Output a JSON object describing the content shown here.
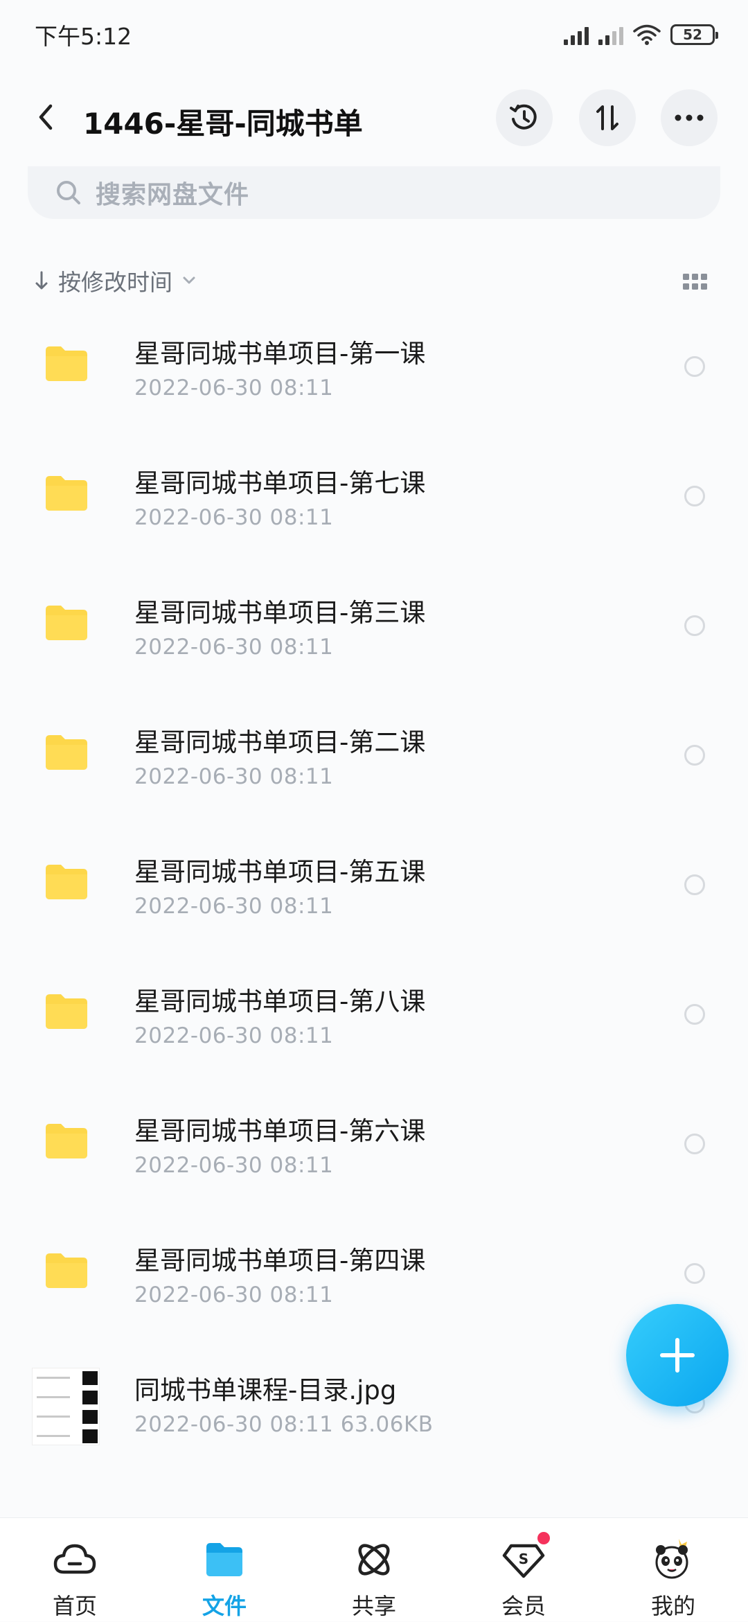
{
  "status_bar": {
    "time": "下午5:12",
    "battery": "52"
  },
  "header": {
    "title": "1446-星哥-同城书单"
  },
  "search": {
    "placeholder": "搜索网盘文件"
  },
  "sort": {
    "label": "按修改时间"
  },
  "files": [
    {
      "name": "星哥同城书单项目-第一课",
      "meta": "2022-06-30  08:11",
      "type": "folder"
    },
    {
      "name": "星哥同城书单项目-第七课",
      "meta": "2022-06-30  08:11",
      "type": "folder"
    },
    {
      "name": "星哥同城书单项目-第三课",
      "meta": "2022-06-30  08:11",
      "type": "folder"
    },
    {
      "name": "星哥同城书单项目-第二课",
      "meta": "2022-06-30  08:11",
      "type": "folder"
    },
    {
      "name": "星哥同城书单项目-第五课",
      "meta": "2022-06-30  08:11",
      "type": "folder"
    },
    {
      "name": "星哥同城书单项目-第八课",
      "meta": "2022-06-30  08:11",
      "type": "folder"
    },
    {
      "name": "星哥同城书单项目-第六课",
      "meta": "2022-06-30  08:11",
      "type": "folder"
    },
    {
      "name": "星哥同城书单项目-第四课",
      "meta": "2022-06-30  08:11",
      "type": "folder"
    },
    {
      "name": "同城书单课程-目录.jpg",
      "meta": "2022-06-30  08:11  63.06KB",
      "type": "image"
    }
  ],
  "nav": {
    "home": "首页",
    "files": "文件",
    "share": "共享",
    "vip": "会员",
    "mine": "我的"
  },
  "colors": {
    "accent": "#14a3e6",
    "folder": "#fdd74a",
    "badge": "#f5325c"
  }
}
